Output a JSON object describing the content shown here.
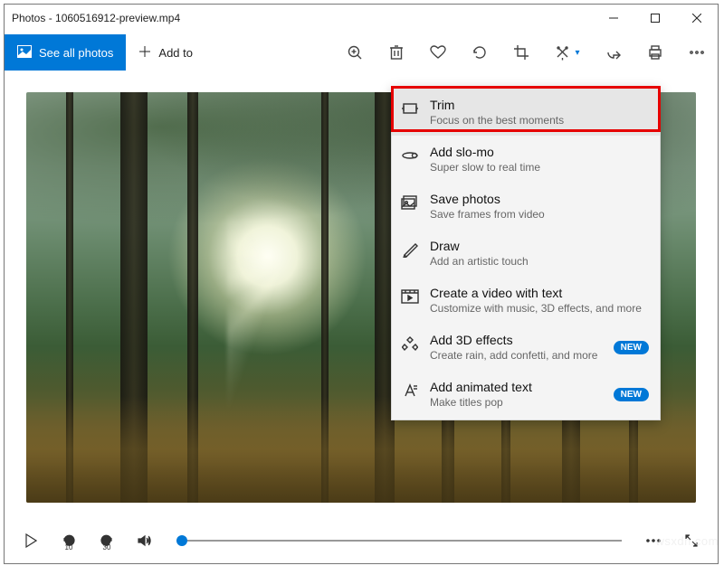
{
  "titlebar": {
    "title": "Photos - 1060516912-preview.mp4"
  },
  "toolbar": {
    "see_all_label": "See all photos",
    "add_to_label": "Add to"
  },
  "edit_menu": {
    "items": [
      {
        "title": "Trim",
        "sub": "Focus on the best moments",
        "new": false
      },
      {
        "title": "Add slo-mo",
        "sub": "Super slow to real time",
        "new": false
      },
      {
        "title": "Save photos",
        "sub": "Save frames from video",
        "new": false
      },
      {
        "title": "Draw",
        "sub": "Add an artistic touch",
        "new": false
      },
      {
        "title": "Create a video with text",
        "sub": "Customize with music, 3D effects, and more",
        "new": false
      },
      {
        "title": "Add 3D effects",
        "sub": "Create rain, add confetti, and more",
        "new": true
      },
      {
        "title": "Add animated text",
        "sub": "Make titles pop",
        "new": true
      }
    ],
    "new_badge_label": "NEW"
  },
  "playbar": {
    "skip_back_label": "10",
    "skip_fwd_label": "30"
  },
  "watermark": "wsxdn.com",
  "colors": {
    "accent": "#0078d7",
    "highlight": "#e60000"
  }
}
